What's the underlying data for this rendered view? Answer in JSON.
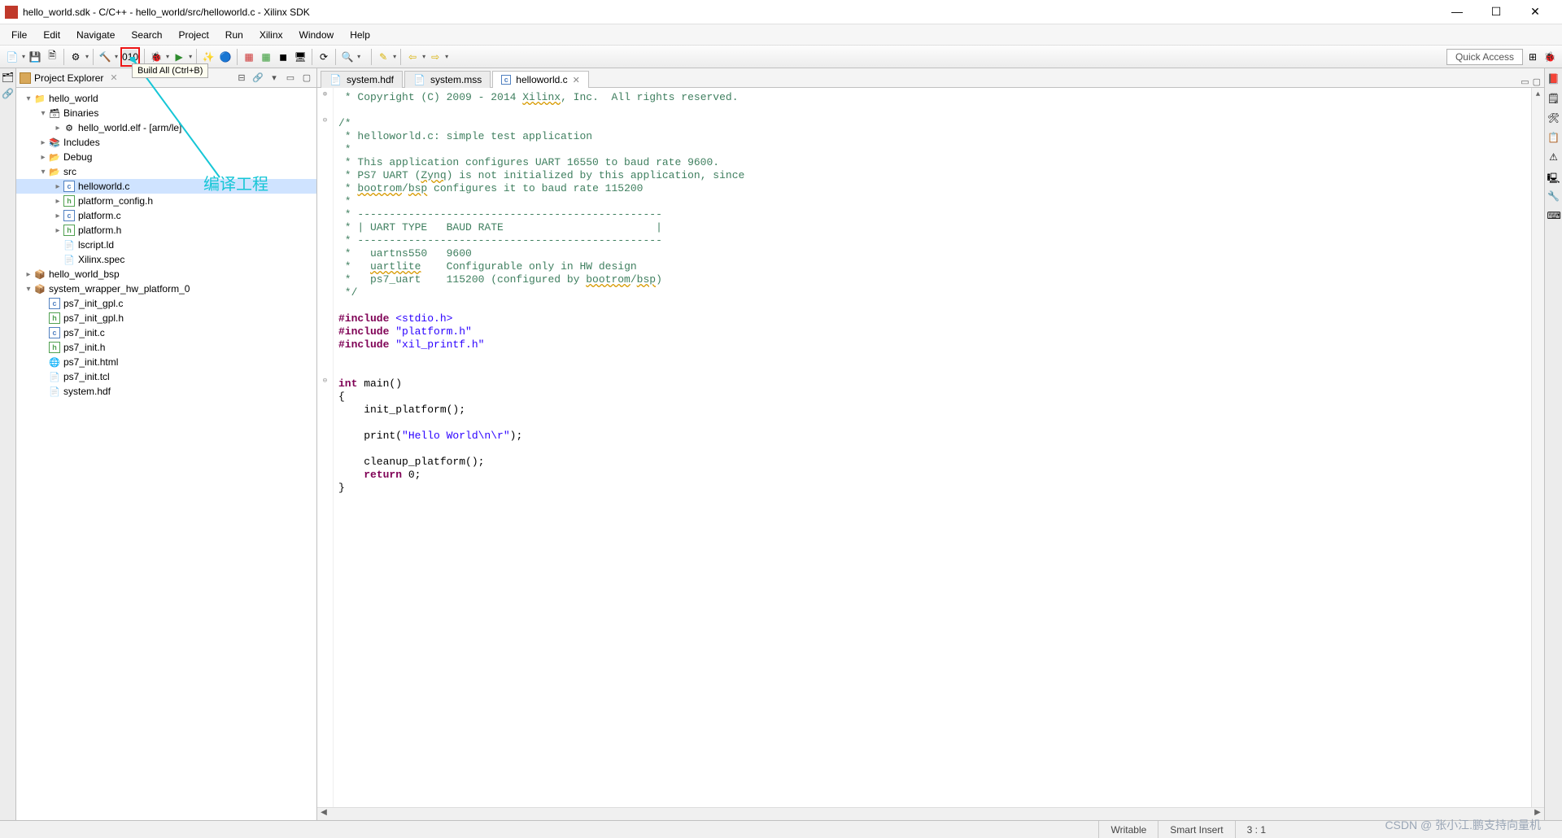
{
  "window": {
    "title": "hello_world.sdk - C/C++ - hello_world/src/helloworld.c - Xilinx SDK"
  },
  "menubar": [
    "File",
    "Edit",
    "Navigate",
    "Search",
    "Project",
    "Run",
    "Xilinx",
    "Window",
    "Help"
  ],
  "tooltip": "Build All (Ctrl+B)",
  "quick_access": "Quick Access",
  "annotation": "编译工程",
  "explorer": {
    "title": "Project Explorer",
    "tree": [
      {
        "d": 0,
        "exp": "▾",
        "ico": "📁",
        "txt": "hello_world"
      },
      {
        "d": 1,
        "exp": "▾",
        "ico": "🗃",
        "txt": "Binaries"
      },
      {
        "d": 2,
        "exp": "▸",
        "ico": "⚙",
        "txt": "hello_world.elf - [arm/le]"
      },
      {
        "d": 1,
        "exp": "▸",
        "ico": "📚",
        "txt": "Includes"
      },
      {
        "d": 1,
        "exp": "▸",
        "ico": "📂",
        "txt": "Debug"
      },
      {
        "d": 1,
        "exp": "▾",
        "ico": "📂",
        "txt": "src"
      },
      {
        "d": 2,
        "exp": "▸",
        "ico": "c",
        "txt": "helloworld.c",
        "sel": true
      },
      {
        "d": 2,
        "exp": "▸",
        "ico": "h",
        "txt": "platform_config.h"
      },
      {
        "d": 2,
        "exp": "▸",
        "ico": "c",
        "txt": "platform.c"
      },
      {
        "d": 2,
        "exp": "▸",
        "ico": "h",
        "txt": "platform.h"
      },
      {
        "d": 2,
        "exp": "",
        "ico": "📄",
        "txt": "lscript.ld"
      },
      {
        "d": 2,
        "exp": "",
        "ico": "📄",
        "txt": "Xilinx.spec"
      },
      {
        "d": 0,
        "exp": "▸",
        "ico": "📦",
        "txt": "hello_world_bsp"
      },
      {
        "d": 0,
        "exp": "▾",
        "ico": "📦",
        "txt": "system_wrapper_hw_platform_0"
      },
      {
        "d": 1,
        "exp": "",
        "ico": "c",
        "txt": "ps7_init_gpl.c"
      },
      {
        "d": 1,
        "exp": "",
        "ico": "h",
        "txt": "ps7_init_gpl.h"
      },
      {
        "d": 1,
        "exp": "",
        "ico": "c",
        "txt": "ps7_init.c"
      },
      {
        "d": 1,
        "exp": "",
        "ico": "h",
        "txt": "ps7_init.h"
      },
      {
        "d": 1,
        "exp": "",
        "ico": "🌐",
        "txt": "ps7_init.html"
      },
      {
        "d": 1,
        "exp": "",
        "ico": "📄",
        "txt": "ps7_init.tcl"
      },
      {
        "d": 1,
        "exp": "",
        "ico": "📄",
        "txt": "system.hdf"
      }
    ]
  },
  "editor": {
    "tabs": [
      {
        "name": "system.hdf",
        "ico": "📄",
        "active": false
      },
      {
        "name": "system.mss",
        "ico": "📄",
        "active": false
      },
      {
        "name": "helloworld.c",
        "ico": "c",
        "active": true
      }
    ],
    "code_lines": [
      {
        "t": " * Copyright (C) 2009 - 2014 ",
        "cls": "c-comment",
        "tail": [
          {
            "t": "Xilinx",
            "cls": "c-comment c-squiggle"
          },
          {
            "t": ", Inc.  All rights reserved.",
            "cls": "c-comment"
          }
        ]
      },
      {
        "t": "",
        "cls": ""
      },
      {
        "t": "/*",
        "cls": "c-comment"
      },
      {
        "t": " * helloworld.c: simple test application",
        "cls": "c-comment"
      },
      {
        "t": " *",
        "cls": "c-comment"
      },
      {
        "t": " * This application configures UART 16550 to baud rate 9600.",
        "cls": "c-comment"
      },
      {
        "t": " * PS7 UART (",
        "cls": "c-comment",
        "tail": [
          {
            "t": "Zynq",
            "cls": "c-comment c-squiggle"
          },
          {
            "t": ") is not initialized by this application, since",
            "cls": "c-comment"
          }
        ]
      },
      {
        "t": " * ",
        "cls": "c-comment",
        "tail": [
          {
            "t": "bootrom",
            "cls": "c-comment c-squiggle"
          },
          {
            "t": "/",
            "cls": "c-comment"
          },
          {
            "t": "bsp",
            "cls": "c-comment c-squiggle"
          },
          {
            "t": " configures it to baud rate 115200",
            "cls": "c-comment"
          }
        ]
      },
      {
        "t": " *",
        "cls": "c-comment"
      },
      {
        "t": " * ------------------------------------------------",
        "cls": "c-comment"
      },
      {
        "t": " * | UART TYPE   BAUD RATE                        |",
        "cls": "c-comment"
      },
      {
        "t": " * ------------------------------------------------",
        "cls": "c-comment"
      },
      {
        "t": " *   uartns550   9600",
        "cls": "c-comment"
      },
      {
        "t": " *   ",
        "cls": "c-comment",
        "tail": [
          {
            "t": "uartlite",
            "cls": "c-comment c-squiggle"
          },
          {
            "t": "    Configurable only in HW design",
            "cls": "c-comment"
          }
        ]
      },
      {
        "t": " *   ps7_uart    115200 (configured by ",
        "cls": "c-comment",
        "tail": [
          {
            "t": "bootrom",
            "cls": "c-comment c-squiggle"
          },
          {
            "t": "/",
            "cls": "c-comment"
          },
          {
            "t": "bsp",
            "cls": "c-comment c-squiggle"
          },
          {
            "t": ")",
            "cls": "c-comment"
          }
        ]
      },
      {
        "t": " */",
        "cls": "c-comment"
      },
      {
        "t": "",
        "cls": ""
      },
      {
        "t": "#include ",
        "cls": "c-kw",
        "tail": [
          {
            "t": "<stdio.h>",
            "cls": "c-str"
          }
        ]
      },
      {
        "t": "#include ",
        "cls": "c-kw",
        "tail": [
          {
            "t": "\"platform.h\"",
            "cls": "c-str"
          }
        ]
      },
      {
        "t": "#include ",
        "cls": "c-kw",
        "tail": [
          {
            "t": "\"xil_printf.h\"",
            "cls": "c-str"
          }
        ]
      },
      {
        "t": "",
        "cls": ""
      },
      {
        "t": "",
        "cls": ""
      },
      {
        "t": "int",
        "cls": "c-kw",
        "tail": [
          {
            "t": " main()",
            "cls": ""
          }
        ]
      },
      {
        "t": "{",
        "cls": ""
      },
      {
        "t": "    init_platform();",
        "cls": ""
      },
      {
        "t": "",
        "cls": ""
      },
      {
        "t": "    print(",
        "cls": "",
        "tail": [
          {
            "t": "\"Hello World\\n\\r\"",
            "cls": "c-str"
          },
          {
            "t": ");",
            "cls": ""
          }
        ]
      },
      {
        "t": "",
        "cls": ""
      },
      {
        "t": "    cleanup_platform();",
        "cls": ""
      },
      {
        "t": "    ",
        "cls": "",
        "tail": [
          {
            "t": "return",
            "cls": "c-kw"
          },
          {
            "t": " 0;",
            "cls": ""
          }
        ]
      },
      {
        "t": "}",
        "cls": ""
      }
    ]
  },
  "status": {
    "writable": "Writable",
    "insert": "Smart Insert",
    "pos": "3 : 1"
  },
  "watermark": "CSDN @  张小江.鹏支持向量机"
}
